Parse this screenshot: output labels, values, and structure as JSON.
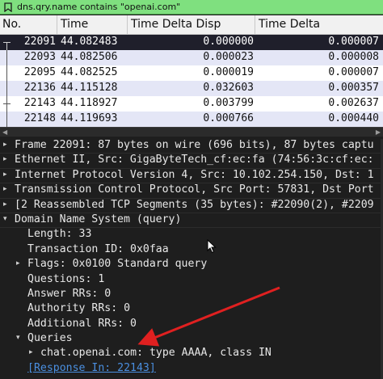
{
  "filter": {
    "icon": "bookmark-filter-icon",
    "text": "dns.qry.name contains \"openai.com\""
  },
  "columns": [
    "No.",
    "Time",
    "Time Delta Disp",
    "Time Delta"
  ],
  "packets": [
    {
      "no": "22091",
      "time": "44.082483",
      "disp": "0.000000",
      "delta": "0.000007",
      "selected": true
    },
    {
      "no": "22093",
      "time": "44.082506",
      "disp": "0.000023",
      "delta": "0.000008"
    },
    {
      "no": "22095",
      "time": "44.082525",
      "disp": "0.000019",
      "delta": "0.000007"
    },
    {
      "no": "22136",
      "time": "44.115128",
      "disp": "0.032603",
      "delta": "0.000357"
    },
    {
      "no": "22143",
      "time": "44.118927",
      "disp": "0.003799",
      "delta": "0.002637"
    },
    {
      "no": "22148",
      "time": "44.119693",
      "disp": "0.000766",
      "delta": "0.000440"
    }
  ],
  "details": [
    {
      "level": 0,
      "arrow": "▸",
      "text": "Frame 22091: 87 bytes on wire (696 bits), 87 bytes captu"
    },
    {
      "level": 0,
      "arrow": "▸",
      "text": "Ethernet II, Src: GigaByteTech_cf:ec:fa (74:56:3c:cf:ec:"
    },
    {
      "level": 0,
      "arrow": "▸",
      "text": "Internet Protocol Version 4, Src: 10.102.254.150, Dst: 1"
    },
    {
      "level": 0,
      "arrow": "▸",
      "text": "Transmission Control Protocol, Src Port: 57831, Dst Port"
    },
    {
      "level": 0,
      "arrow": "▸",
      "text": "[2 Reassembled TCP Segments (35 bytes): #22090(2), #2209"
    },
    {
      "level": 0,
      "arrow": "▾",
      "text": "Domain Name System (query)"
    },
    {
      "level": 1,
      "arrow": "",
      "text": "Length: 33"
    },
    {
      "level": 1,
      "arrow": "",
      "text": "Transaction ID: 0x0faa"
    },
    {
      "level": 1,
      "arrow": "▸",
      "text": "Flags: 0x0100 Standard query"
    },
    {
      "level": 1,
      "arrow": "",
      "text": "Questions: 1"
    },
    {
      "level": 1,
      "arrow": "",
      "text": "Answer RRs: 0"
    },
    {
      "level": 1,
      "arrow": "",
      "text": "Authority RRs: 0"
    },
    {
      "level": 1,
      "arrow": "",
      "text": "Additional RRs: 0"
    },
    {
      "level": 1,
      "arrow": "▾",
      "text": "Queries"
    },
    {
      "level": 2,
      "arrow": "▸",
      "text": "chat.openai.com: type AAAA, class IN"
    },
    {
      "level": 1,
      "arrow": "",
      "text": "[Response In: 22143]",
      "link": true
    }
  ],
  "colors": {
    "filter_bg": "#7fe07f",
    "selected_row": "#1f1f2b",
    "alt_row": "#e4e6f6",
    "annotation_arrow": "#e02020",
    "link": "#4a8fe0"
  }
}
